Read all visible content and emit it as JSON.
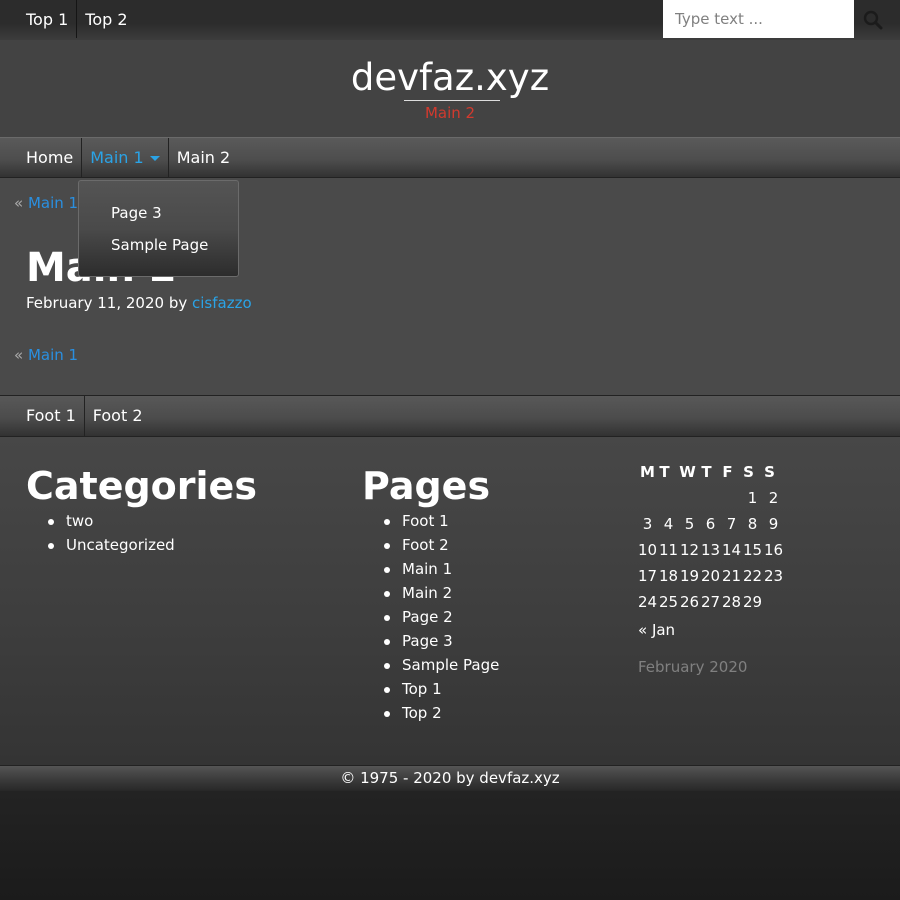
{
  "topnav": {
    "items": [
      "Top 1",
      "Top 2"
    ]
  },
  "search": {
    "placeholder": "Type text ..."
  },
  "header": {
    "site_title": "devfaz.xyz",
    "tagline": "Main 2"
  },
  "mainnav": {
    "items": [
      "Home",
      "Main 1",
      "Main 2"
    ],
    "dropdown": [
      "Page 3",
      "Sample Page"
    ]
  },
  "content": {
    "back_link_prefix": "«",
    "back_link": "Main 1",
    "post_title": "Main 2",
    "post_date": "February 11, 2020",
    "post_by": "by",
    "post_author": "cisfazzo"
  },
  "footnav": {
    "items": [
      "Foot 1",
      "Foot 2"
    ]
  },
  "widgets": {
    "categories_title": "Categories",
    "categories": [
      "two",
      "Uncategorized"
    ],
    "pages_title": "Pages",
    "pages": [
      "Foot 1",
      "Foot 2",
      "Main 1",
      "Main 2",
      "Page 2",
      "Page 3",
      "Sample Page",
      "Top 1",
      "Top 2"
    ]
  },
  "calendar": {
    "caption": "February 2020",
    "weekday_headers": [
      "M",
      "T",
      "W",
      "T",
      "F",
      "S",
      "S"
    ],
    "weeks": [
      [
        "",
        "",
        "",
        "",
        "",
        "1",
        "2"
      ],
      [
        "3",
        "4",
        "5",
        "6",
        "7",
        "8",
        "9"
      ],
      [
        "10",
        "11",
        "12",
        "13",
        "14",
        "15",
        "16"
      ],
      [
        "17",
        "18",
        "19",
        "20",
        "21",
        "22",
        "23"
      ],
      [
        "24",
        "25",
        "26",
        "27",
        "28",
        "29",
        ""
      ]
    ],
    "prev_link": "« Jan"
  },
  "footer": {
    "copyright": "© 1975 - 2020 by devfaz.xyz"
  },
  "colors": {
    "link_blue": "#2aa3e6",
    "tagline_red": "#d23a2e",
    "background": "#4a4a4a"
  },
  "icons": {
    "search": "search-icon",
    "dropdown": "caret-down-icon"
  }
}
